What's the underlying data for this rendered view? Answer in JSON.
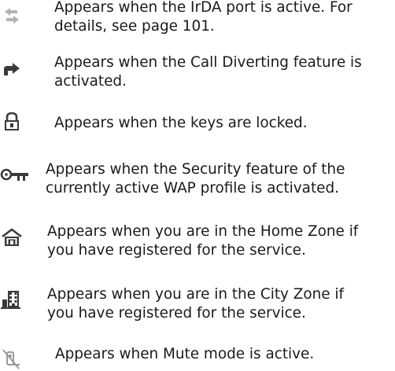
{
  "entries": [
    {
      "icon": "irda-arrows-icon",
      "lines": [
        "Appears when the IrDA port is active. For",
        "details, see page 101."
      ]
    },
    {
      "icon": "call-divert-icon",
      "lines": [
        "Appears when the Call Diverting feature is",
        "activated."
      ]
    },
    {
      "icon": "padlock-icon",
      "lines": [
        "Appears when the keys are locked."
      ]
    },
    {
      "icon": "key-icon",
      "lines": [
        "Appears when the Security feature of the",
        "currently active WAP profile is activated."
      ]
    },
    {
      "icon": "home-zone-icon",
      "lines": [
        "Appears when you are in the Home Zone if",
        "you have registered for the service."
      ]
    },
    {
      "icon": "city-zone-icon",
      "lines": [
        "Appears when you are in the City Zone if",
        "you have registered for the service."
      ]
    },
    {
      "icon": "mute-icon",
      "lines": [
        "Appears when Mute mode is active."
      ]
    }
  ]
}
